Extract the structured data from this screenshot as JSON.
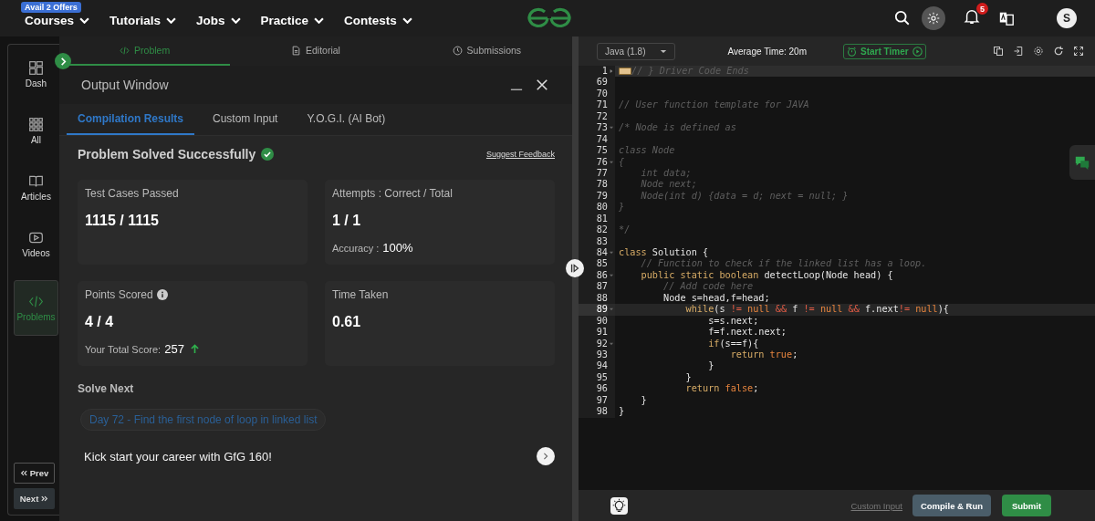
{
  "nav": {
    "offer_badge": "Avail 2 Offers",
    "menus": [
      "Courses",
      "Tutorials",
      "Jobs",
      "Practice",
      "Contests"
    ],
    "notification_count": "5",
    "avatar_initial": "S"
  },
  "sidebar": {
    "items": [
      {
        "label": "Dash",
        "selected": false
      },
      {
        "label": "All",
        "selected": false
      },
      {
        "label": "Articles",
        "selected": false
      },
      {
        "label": "Videos",
        "selected": false
      },
      {
        "label": "Problems",
        "selected": true
      }
    ],
    "prev": "Prev",
    "next": "Next"
  },
  "problem_tabs": [
    {
      "label": "Problem",
      "selected": true
    },
    {
      "label": "Editorial",
      "selected": false
    },
    {
      "label": "Submissions",
      "selected": false
    }
  ],
  "output_window": {
    "title": "Output Window",
    "tabs": [
      {
        "label": "Compilation Results",
        "selected": true
      },
      {
        "label": "Custom Input",
        "selected": false
      },
      {
        "label": "Y.O.G.I. (AI Bot)",
        "selected": false
      }
    ],
    "status": "Problem Solved Successfully",
    "feedback_link": "Suggest Feedback",
    "cards": [
      {
        "label": "Test Cases Passed",
        "value": "1115 / 1115",
        "info": false
      },
      {
        "label": "Attempts : Correct / Total",
        "value": "1 / 1",
        "info": false,
        "extra_label": "Accuracy :",
        "extra_value": "100%"
      },
      {
        "label": "Points Scored",
        "value": "4 / 4",
        "info": true,
        "extra_label": "Your Total Score:",
        "extra_value": "257"
      },
      {
        "label": "Time Taken",
        "value": "0.61",
        "info": false
      }
    ],
    "solve_next_heading": "Solve Next",
    "next_problem": "Day 72 - Find the first node of loop in linked list",
    "promo": "Kick start your career with GfG 160!"
  },
  "editor": {
    "language": "Java (1.8)",
    "average_time": "Average Time: 20m",
    "timer_button": "Start Timer",
    "lines": [
      {
        "num": "1",
        "collapsible": true,
        "collapsed": true,
        "active": false,
        "tokens": [
          {
            "kind": "comment",
            "text": "// } Driver Code Ends"
          }
        ]
      },
      {
        "num": "69",
        "collapsible": false,
        "active": false
      },
      {
        "num": "70",
        "collapsible": false,
        "active": false
      },
      {
        "num": "71",
        "collapsible": false,
        "active": false,
        "tokens": [
          {
            "kind": "comment",
            "text": "// User function template for JAVA"
          }
        ]
      },
      {
        "num": "72",
        "collapsible": false,
        "active": false
      },
      {
        "num": "73",
        "collapsible": true,
        "collapsed": false,
        "active": false,
        "tokens": [
          {
            "kind": "comment",
            "text": "/* Node is defined as"
          }
        ]
      },
      {
        "num": "74",
        "collapsible": false,
        "active": false
      },
      {
        "num": "75",
        "collapsible": false,
        "active": false,
        "tokens": [
          {
            "kind": "comment",
            "text": "class Node"
          }
        ]
      },
      {
        "num": "76",
        "collapsible": true,
        "collapsed": false,
        "active": false,
        "tokens": [
          {
            "kind": "comment",
            "text": "{"
          }
        ]
      },
      {
        "num": "77",
        "collapsible": false,
        "active": false,
        "tokens": [
          {
            "kind": "comment",
            "text": "    int data;"
          }
        ]
      },
      {
        "num": "78",
        "collapsible": false,
        "active": false,
        "tokens": [
          {
            "kind": "comment",
            "text": "    Node next;"
          }
        ]
      },
      {
        "num": "79",
        "collapsible": false,
        "active": false,
        "tokens": [
          {
            "kind": "comment",
            "text": "    Node(int d) {data = d; next = null; }"
          }
        ]
      },
      {
        "num": "80",
        "collapsible": false,
        "active": false,
        "tokens": [
          {
            "kind": "comment",
            "text": "}"
          }
        ]
      },
      {
        "num": "81",
        "collapsible": false,
        "active": false
      },
      {
        "num": "82",
        "collapsible": false,
        "active": false,
        "tokens": [
          {
            "kind": "comment",
            "text": "*/"
          }
        ]
      },
      {
        "num": "83",
        "collapsible": false,
        "active": false
      },
      {
        "num": "84",
        "collapsible": true,
        "collapsed": false,
        "active": false,
        "tokens": [
          {
            "kind": "kw",
            "text": "class"
          },
          {
            "kind": "plain",
            "text": " Solution {"
          }
        ]
      },
      {
        "num": "85",
        "collapsible": false,
        "active": false,
        "tokens": [
          {
            "kind": "comment",
            "text": "    // Function to check if the linked list has a loop."
          }
        ]
      },
      {
        "num": "86",
        "collapsible": true,
        "collapsed": false,
        "active": false,
        "tokens": [
          {
            "kind": "kw",
            "text": "    public static boolean"
          },
          {
            "kind": "plain",
            "text": " detectLoop(Node head) {"
          }
        ]
      },
      {
        "num": "87",
        "collapsible": false,
        "active": false,
        "tokens": [
          {
            "kind": "comment",
            "text": "        // Add code here"
          }
        ]
      },
      {
        "num": "88",
        "collapsible": false,
        "active": false,
        "tokens": [
          {
            "kind": "plain",
            "text": "        Node s=head,f=head;"
          }
        ]
      },
      {
        "num": "89",
        "collapsible": true,
        "collapsed": false,
        "active": true,
        "tokens": [
          {
            "kind": "kw",
            "text": "            while"
          },
          {
            "kind": "plain",
            "text": "(s "
          },
          {
            "kind": "op",
            "text": "!="
          },
          {
            "kind": "lit",
            "text": " null "
          },
          {
            "kind": "op",
            "text": "&&"
          },
          {
            "kind": "plain",
            "text": " f "
          },
          {
            "kind": "op",
            "text": "!="
          },
          {
            "kind": "lit",
            "text": " null "
          },
          {
            "kind": "op",
            "text": "&&"
          },
          {
            "kind": "plain",
            "text": " f.next"
          },
          {
            "kind": "op",
            "text": "!="
          },
          {
            "kind": "lit",
            "text": " null"
          },
          {
            "kind": "plain",
            "text": "){"
          }
        ]
      },
      {
        "num": "90",
        "collapsible": false,
        "active": false,
        "tokens": [
          {
            "kind": "plain",
            "text": "                s=s.next;"
          }
        ]
      },
      {
        "num": "91",
        "collapsible": false,
        "active": false,
        "tokens": [
          {
            "kind": "plain",
            "text": "                f=f.next.next;"
          }
        ]
      },
      {
        "num": "92",
        "collapsible": true,
        "collapsed": false,
        "active": false,
        "tokens": [
          {
            "kind": "kw",
            "text": "                if"
          },
          {
            "kind": "plain",
            "text": "(s==f){"
          }
        ]
      },
      {
        "num": "93",
        "collapsible": false,
        "active": false,
        "tokens": [
          {
            "kind": "kw",
            "text": "                    return"
          },
          {
            "kind": "lit",
            "text": " true"
          },
          {
            "kind": "plain",
            "text": ";"
          }
        ]
      },
      {
        "num": "94",
        "collapsible": false,
        "active": false,
        "tokens": [
          {
            "kind": "plain",
            "text": "                }"
          }
        ]
      },
      {
        "num": "95",
        "collapsible": false,
        "active": false,
        "tokens": [
          {
            "kind": "plain",
            "text": "            }"
          }
        ]
      },
      {
        "num": "96",
        "collapsible": false,
        "active": false,
        "tokens": [
          {
            "kind": "kw",
            "text": "            return"
          },
          {
            "kind": "lit",
            "text": " false"
          },
          {
            "kind": "plain",
            "text": ";"
          }
        ]
      },
      {
        "num": "97",
        "collapsible": false,
        "active": false,
        "tokens": [
          {
            "kind": "plain",
            "text": "    }"
          }
        ]
      },
      {
        "num": "98",
        "collapsible": false,
        "active": false,
        "tokens": [
          {
            "kind": "plain",
            "text": "}"
          }
        ]
      }
    ],
    "custom_input_link": "Custom Input",
    "compile_button": "Compile & Run",
    "submit_button": "Submit"
  }
}
